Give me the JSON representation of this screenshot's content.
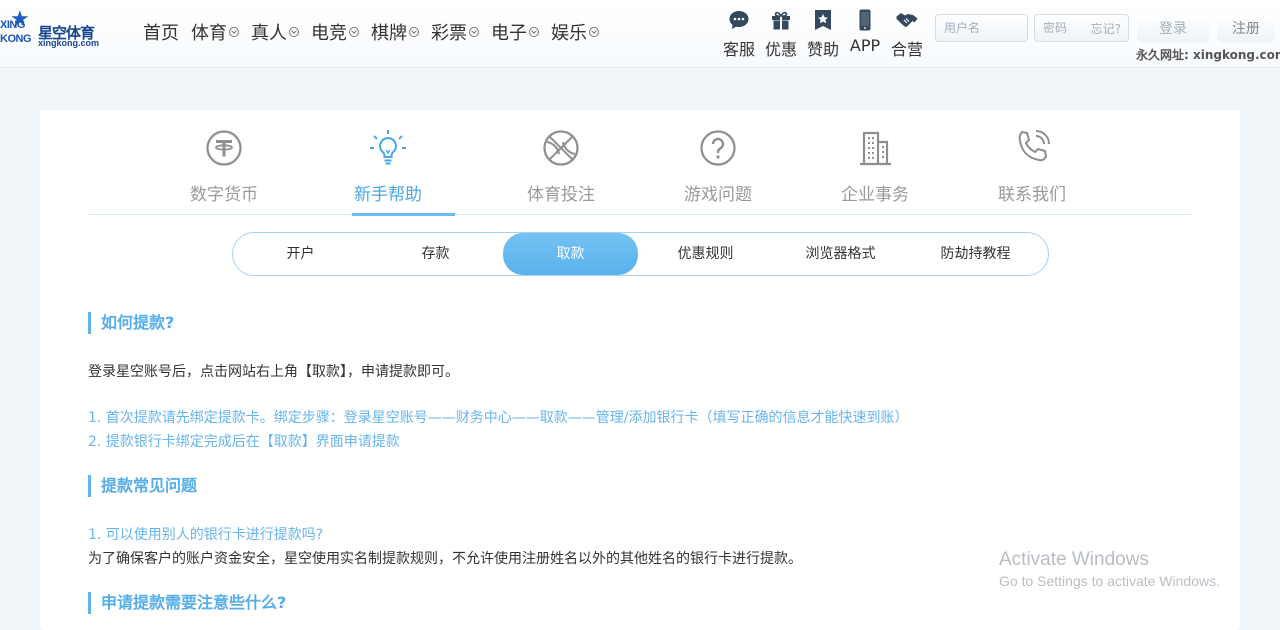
{
  "logo": {
    "line1": "XING",
    "line2": "KONG",
    "name": "星空体育",
    "domain": "xingkong.com"
  },
  "nav": [
    {
      "label": "首页",
      "has_dropdown": false
    },
    {
      "label": "体育",
      "has_dropdown": true
    },
    {
      "label": "真人",
      "has_dropdown": true
    },
    {
      "label": "电竞",
      "has_dropdown": true
    },
    {
      "label": "棋牌",
      "has_dropdown": true
    },
    {
      "label": "彩票",
      "has_dropdown": true
    },
    {
      "label": "电子",
      "has_dropdown": true
    },
    {
      "label": "娱乐",
      "has_dropdown": true
    }
  ],
  "quicklinks": [
    {
      "label": "客服",
      "icon": "chat-bubble-icon"
    },
    {
      "label": "优惠",
      "icon": "gift-icon"
    },
    {
      "label": "赞助",
      "icon": "star-badge-icon"
    },
    {
      "label": "APP",
      "icon": "phone-icon"
    },
    {
      "label": "合营",
      "icon": "handshake-icon"
    }
  ],
  "login": {
    "username_placeholder": "用户名",
    "password_placeholder": "密码",
    "forgot_label": "忘记?",
    "login_label": "登录",
    "register_label": "注册"
  },
  "permanent_url": "永久网址: xingkong.com",
  "categories": [
    {
      "label": "数字货币",
      "icon": "tether-coin-icon",
      "active": false
    },
    {
      "label": "新手帮助",
      "icon": "lightbulb-icon",
      "active": true
    },
    {
      "label": "体育投注",
      "icon": "basketball-icon",
      "active": false
    },
    {
      "label": "游戏问题",
      "icon": "question-circle-icon",
      "active": false
    },
    {
      "label": "企业事务",
      "icon": "building-icon",
      "active": false
    },
    {
      "label": "联系我们",
      "icon": "phone-call-icon",
      "active": false
    }
  ],
  "subtabs": [
    {
      "label": "开户",
      "active": false
    },
    {
      "label": "存款",
      "active": false
    },
    {
      "label": "取款",
      "active": true
    },
    {
      "label": "优惠规则",
      "active": false
    },
    {
      "label": "浏览器格式",
      "active": false
    },
    {
      "label": "防劫持教程",
      "active": false
    }
  ],
  "content": {
    "section1_title": "如何提款?",
    "section1_intro": "登录星空账号后，点击网站右上角【取款】，申请提款即可。",
    "section1_step1": "1. 首次提款请先绑定提款卡。绑定步骤：登录星空账号——财务中心——取款——管理/添加银行卡（填写正确的信息才能快速到账）",
    "section1_step2": "2. 提款银行卡绑定完成后在【取款】界面申请提款",
    "section2_title": "提款常见问题",
    "section2_q1": "1. 可以使用别人的银行卡进行提款吗?",
    "section2_a1": "为了确保客户的账户资金安全，星空使用实名制提款规则，不允许使用注册姓名以外的其他姓名的银行卡进行提款。",
    "section3_title": "申请提款需要注意些什么?"
  },
  "watermark": {
    "line1": "Activate Windows",
    "line2": "Go to Settings to activate Windows."
  },
  "colors": {
    "accent": "#56aee8",
    "active_tab_bg": "#5ab2ec",
    "brand_blue": "#1a56b8"
  }
}
